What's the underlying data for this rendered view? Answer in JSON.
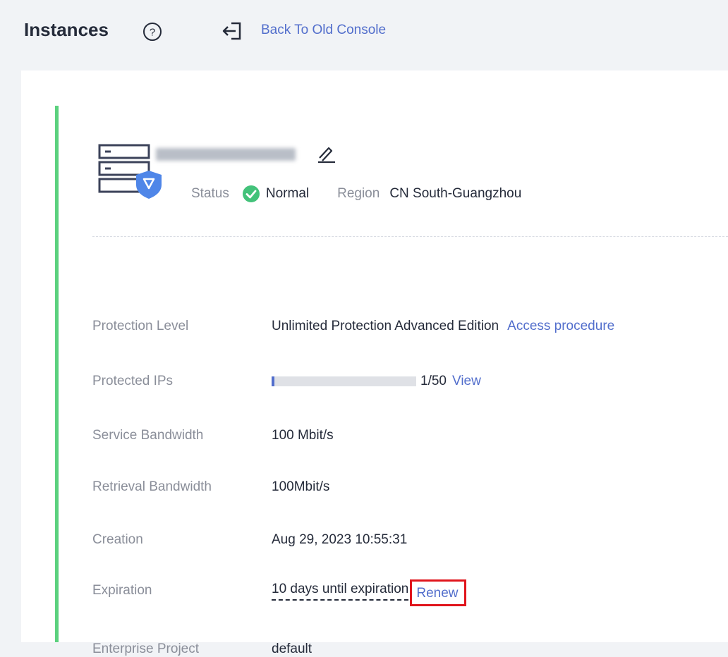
{
  "header": {
    "title": "Instances",
    "back_link": "Back To Old Console"
  },
  "instance": {
    "status_label": "Status",
    "status_value": "Normal",
    "region_label": "Region",
    "region_value": "CN South-Guangzhou"
  },
  "details": {
    "protection_level": {
      "label": "Protection Level",
      "value": "Unlimited Protection Advanced Edition",
      "link": "Access procedure"
    },
    "protected_ips": {
      "label": "Protected IPs",
      "used": 1,
      "total": 50,
      "value": "1/50",
      "link": "View"
    },
    "service_bandwidth": {
      "label": "Service Bandwidth",
      "value": "100 Mbit/s"
    },
    "retrieval_bandwidth": {
      "label": "Retrieval Bandwidth",
      "value": "100Mbit/s"
    },
    "creation": {
      "label": "Creation",
      "value": "Aug 29, 2023 10:55:31"
    },
    "expiration": {
      "label": "Expiration",
      "value": "10 days until expiration",
      "link": "Renew"
    },
    "enterprise_project": {
      "label": "Enterprise Project",
      "value": "default"
    }
  },
  "colors": {
    "accent": "#526ecc",
    "status_ok": "#43c27a",
    "card_border": "#5bd17e",
    "highlight": "#e0151c"
  },
  "icons": {
    "help": "question-circle-icon",
    "back": "exit-arrow-icon",
    "server": "server-shield-icon",
    "edit": "pencil-icon",
    "status": "check-circle-icon"
  }
}
